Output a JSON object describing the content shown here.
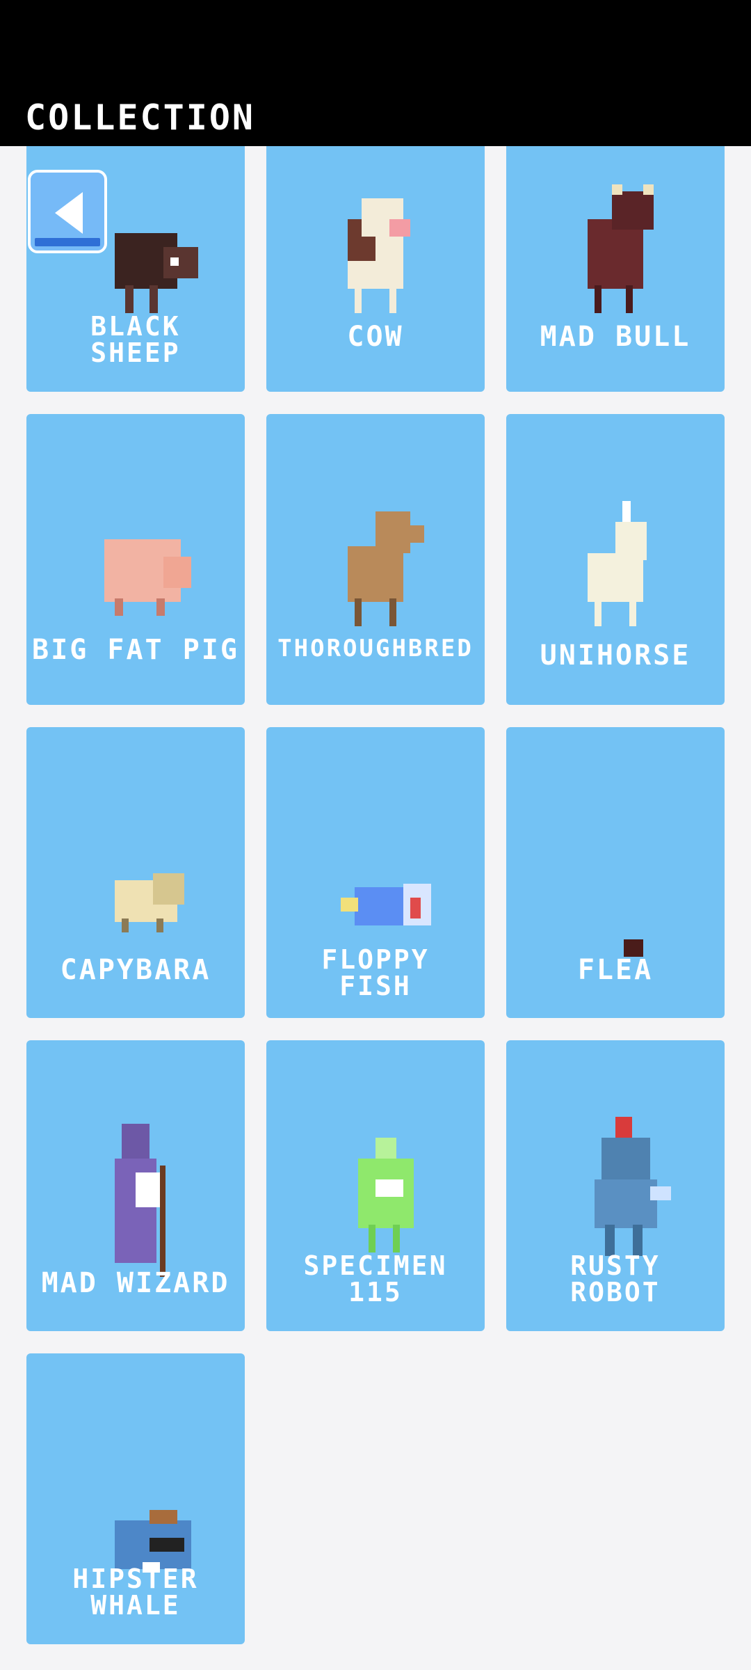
{
  "header": {
    "title": "COLLECTION"
  },
  "back_button": {
    "icon": "back-arrow-icon"
  },
  "characters": [
    {
      "name": "BLACK\nSHEEP",
      "line1": "BLACK",
      "line2": "SHEEP"
    },
    {
      "name": "COW",
      "line1": "COW"
    },
    {
      "name": "MAD BULL",
      "line1": "MAD BULL"
    },
    {
      "name": "BIG FAT PIG",
      "line1": "BIG FAT PIG"
    },
    {
      "name": "THOROUGHBRED",
      "line1": "THOROUGHBRED"
    },
    {
      "name": "UNIHORSE",
      "line1": "UNIHORSE"
    },
    {
      "name": "CAPYBARA",
      "line1": "CAPYBARA"
    },
    {
      "name": "FLOPPY\nFISH",
      "line1": "FLOPPY",
      "line2": "FISH"
    },
    {
      "name": "FLEA",
      "line1": "FLEA"
    },
    {
      "name": "MAD WIZARD",
      "line1": "MAD WIZARD"
    },
    {
      "name": "SPECIMEN\n115",
      "line1": "SPECIMEN",
      "line2": "115"
    },
    {
      "name": "RUSTY\nROBOT",
      "line1": "RUSTY",
      "line2": "ROBOT"
    },
    {
      "name": "HIPSTER\nWHALE",
      "line1": "HIPSTER",
      "line2": "WHALE"
    }
  ],
  "colors": {
    "card": "#73c2f4",
    "header": "#000000",
    "background": "#f4f4f6"
  }
}
